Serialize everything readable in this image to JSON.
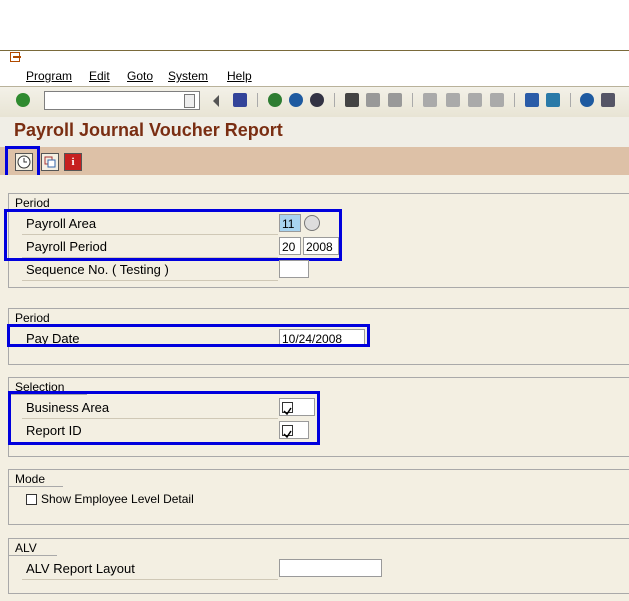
{
  "menu": {
    "items": [
      "Program",
      "Edit",
      "Goto",
      "System",
      "Help"
    ]
  },
  "toolbar": {
    "command_value": "",
    "icons": [
      "enter-icon",
      "save-icon",
      "back-icon",
      "exit-icon",
      "cancel-icon",
      "print-icon",
      "find-icon",
      "find-next-icon",
      "first-page-icon",
      "prev-page-icon",
      "next-page-icon",
      "last-page-icon",
      "create-session-icon",
      "shortcut-icon",
      "help-icon",
      "layout-icon"
    ]
  },
  "title": "Payroll Journal Voucher Report",
  "app_toolbar": {
    "buttons": [
      "execute-icon",
      "get-variant-icon",
      "info-icon"
    ]
  },
  "period1": {
    "title": "Period",
    "payroll_area_label": "Payroll Area",
    "payroll_area_value": "11",
    "payroll_period_label": "Payroll Period",
    "payroll_period_value": "20",
    "payroll_period_year": "2008",
    "sequence_label": "Sequence No. ( Testing )",
    "sequence_value": ""
  },
  "period2": {
    "title": "Period",
    "pay_date_label": "Pay Date",
    "pay_date_value": "10/24/2008"
  },
  "selection": {
    "title": "Selection",
    "business_area_label": "Business Area",
    "business_area_checked": true,
    "report_id_label": "Report ID",
    "report_id_checked": true
  },
  "mode": {
    "title": "Mode",
    "show_employee_label": "Show Employee Level Detail",
    "show_employee_checked": false
  },
  "alv": {
    "title": "ALV",
    "layout_label": "ALV Report Layout",
    "layout_value": ""
  },
  "colors": {
    "highlight": "#0000dd",
    "title_text": "#7a2e12",
    "app_toolbar_bg": "#ddc1a7",
    "screen_bg": "#f3efe2"
  }
}
